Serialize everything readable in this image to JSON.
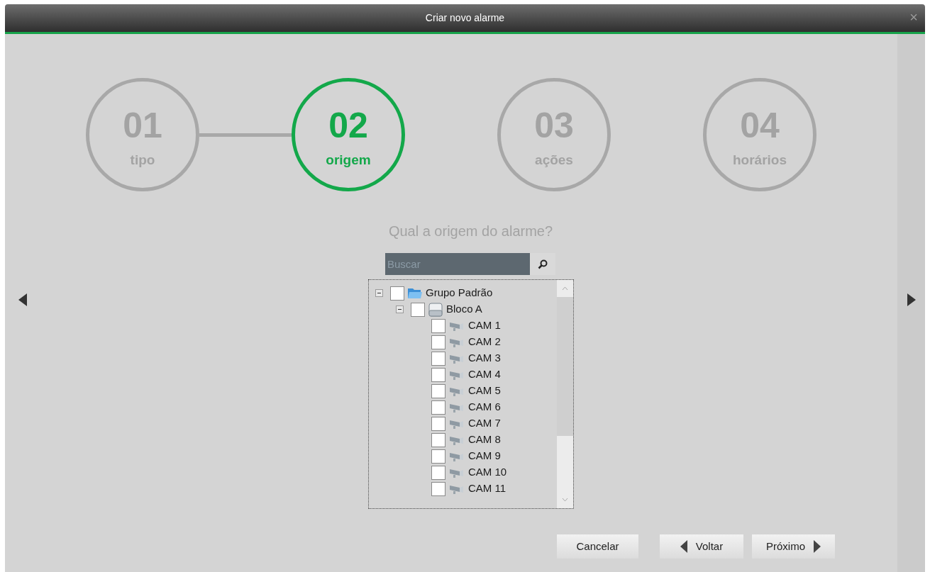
{
  "window": {
    "title": "Criar novo alarme",
    "close": "×"
  },
  "steps": [
    {
      "number": "01",
      "label": "tipo",
      "selected": false,
      "completed": true
    },
    {
      "number": "02",
      "label": "origem",
      "selected": true,
      "completed": false
    },
    {
      "number": "03",
      "label": "ações",
      "selected": false,
      "completed": false
    },
    {
      "number": "04",
      "label": "horários",
      "selected": false
    }
  ],
  "question": "Qual a origem do alarme?",
  "search": {
    "placeholder": "Buscar"
  },
  "tree": [
    {
      "kind": "group",
      "label": "Grupo Padrão",
      "checked": false,
      "expanded": true,
      "children": [
        {
          "kind": "device",
          "label": "Bloco A",
          "checked": false,
          "expanded": true,
          "children": [
            {
              "kind": "camera",
              "label": "CAM 1",
              "checked": false
            },
            {
              "kind": "camera",
              "label": "CAM 2",
              "checked": false
            },
            {
              "kind": "camera",
              "label": "CAM 3",
              "checked": false
            },
            {
              "kind": "camera",
              "label": "CAM 4",
              "checked": false
            },
            {
              "kind": "camera",
              "label": "CAM 5",
              "checked": false
            },
            {
              "kind": "camera",
              "label": "CAM 6",
              "checked": false
            },
            {
              "kind": "camera",
              "label": "CAM 7",
              "checked": false
            },
            {
              "kind": "camera",
              "label": "CAM 8",
              "checked": false
            },
            {
              "kind": "camera",
              "label": "CAM 9",
              "checked": false
            },
            {
              "kind": "camera",
              "label": "CAM 10",
              "checked": false
            },
            {
              "kind": "camera",
              "label": "CAM 11",
              "checked": false
            }
          ]
        }
      ]
    }
  ],
  "buttons": {
    "cancel": "Cancelar",
    "back": "Voltar",
    "next": "Próximo"
  }
}
